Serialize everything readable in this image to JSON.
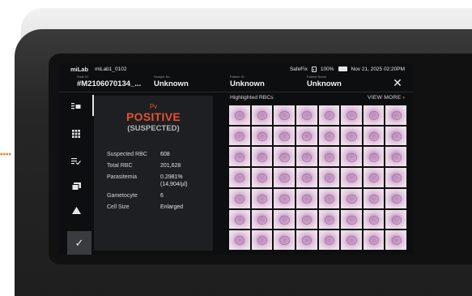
{
  "status_bar": {
    "brand": "miLab",
    "device_id": "miLab1_0102",
    "safefix": "SafeFix",
    "battery": "100%",
    "datetime": "Nov 21, 2025 02:20PM"
  },
  "header": {
    "slide_id": {
      "label": "Slide ID",
      "value": "#M2106070134_..."
    },
    "sample_no": {
      "label": "Sample No.",
      "value": "Unknown"
    },
    "patient_id": {
      "label": "Patient ID",
      "value": "Unknown"
    },
    "patient_name": {
      "label": "Patient Name",
      "value": "Unknown"
    },
    "close": "✕"
  },
  "result": {
    "species": "Pv",
    "status": "POSITIVE",
    "qualifier": "(SUSPECTED)",
    "stats": [
      {
        "key": "Suspected RBC",
        "value": "608"
      },
      {
        "key": "Total RBC",
        "value": "201,628"
      },
      {
        "key": "Parasitemia",
        "value": "0.2981%\n(14,904/µl)"
      },
      {
        "key": "Gametocyte",
        "value": "6"
      },
      {
        "key": "Cell Size",
        "value": "Enlarged"
      }
    ]
  },
  "rbc": {
    "title": "Highlighted RBCs",
    "view_more": "VIEW MORE  ›"
  },
  "sidebar": {
    "items": [
      "summary-icon",
      "grid-icon",
      "list-check-icon",
      "image-icon",
      "warning-icon"
    ],
    "confirm": "✓"
  },
  "colors": {
    "accent_positive": "#e8512e",
    "screen_bg": "#0d0e10",
    "panel_bg": "#1e1f22"
  }
}
